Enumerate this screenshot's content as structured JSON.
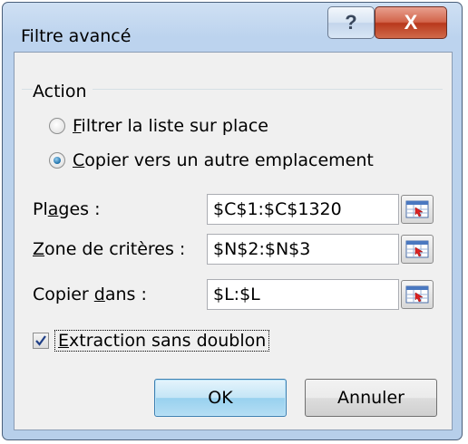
{
  "window": {
    "title": "Filtre avancé",
    "help_glyph": "?",
    "close_glyph": "X"
  },
  "action_group": {
    "label": "Action",
    "options": [
      {
        "accel": "F",
        "rest": "iltrer la liste sur place",
        "checked": false
      },
      {
        "accel": "C",
        "rest": "opier vers un autre emplacement",
        "checked": true
      }
    ]
  },
  "fields": [
    {
      "label_pre": "Pl",
      "accel": "a",
      "label_post": "ges :",
      "value": "$C$1:$C$1320",
      "icon": "range-picker-icon"
    },
    {
      "label_pre": "",
      "accel": "Z",
      "label_post": "one de critères :",
      "value": "$N$2:$N$3",
      "icon": "range-picker-icon"
    },
    {
      "label_pre": "Copier ",
      "accel": "d",
      "label_post": "ans :",
      "value": "$L:$L",
      "icon": "range-picker-icon"
    }
  ],
  "unique_records": {
    "accel": "E",
    "rest": "xtraction sans doublon",
    "checked": true
  },
  "buttons": {
    "ok": "OK",
    "cancel": "Annuler"
  },
  "colors": {
    "accent": "#3c7fb1",
    "close": "#c5462a"
  }
}
